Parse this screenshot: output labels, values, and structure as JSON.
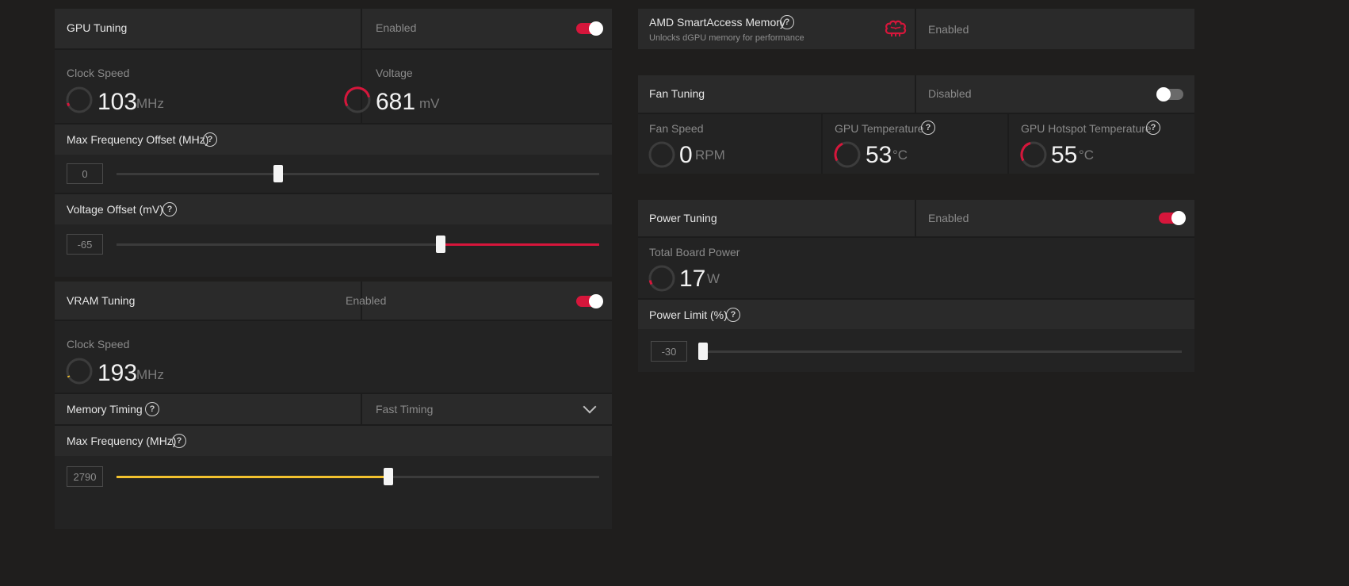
{
  "gpu_tuning": {
    "title": "GPU Tuning",
    "status": "Enabled",
    "clock_label": "Clock Speed",
    "clock_value": "103",
    "clock_unit": "MHz",
    "voltage_label": "Voltage",
    "voltage_value": "681",
    "voltage_unit": "mV",
    "max_freq_offset_label": "Max Frequency Offset (MHz)",
    "max_freq_offset_value": "0",
    "voltage_offset_label": "Voltage Offset (mV)",
    "voltage_offset_value": "-65"
  },
  "vram_tuning": {
    "title": "VRAM Tuning",
    "status": "Enabled",
    "clock_label": "Clock Speed",
    "clock_value": "193",
    "clock_unit": "MHz",
    "memory_timing_label": "Memory Timing",
    "memory_timing_value": "Fast Timing",
    "max_freq_label": "Max Frequency (MHz)",
    "max_freq_value": "2790"
  },
  "smart_access": {
    "title": "AMD SmartAccess Memory",
    "subtitle": "Unlocks dGPU memory for performance",
    "status": "Enabled",
    "icon": "brain-icon"
  },
  "fan_tuning": {
    "title": "Fan Tuning",
    "status": "Disabled",
    "fan_speed_label": "Fan Speed",
    "fan_speed_value": "0",
    "fan_speed_unit": "RPM",
    "gpu_temp_label": "GPU Temperature",
    "gpu_temp_value": "53",
    "gpu_temp_unit": "°C",
    "hotspot_label": "GPU Hotspot Temperature",
    "hotspot_value": "55",
    "hotspot_unit": "°C"
  },
  "power_tuning": {
    "title": "Power Tuning",
    "status": "Enabled",
    "board_power_label": "Total Board Power",
    "board_power_value": "17",
    "board_power_unit": "W",
    "power_limit_label": "Power Limit (%)",
    "power_limit_value": "-30"
  },
  "help_glyph": "?",
  "colors": {
    "accent_red": "#d6163b",
    "accent_yellow": "#f2c12e",
    "toggle_off": "#6a6a6a"
  }
}
